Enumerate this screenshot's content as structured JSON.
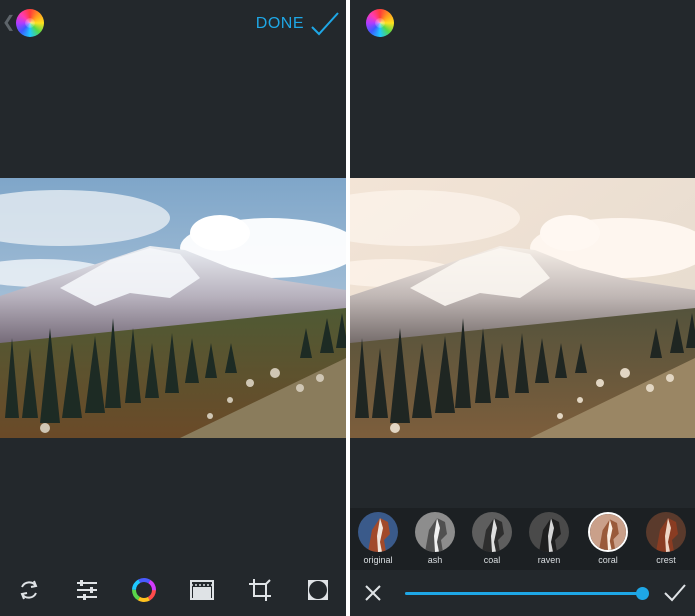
{
  "left_panel": {
    "back_icon": "chevron-left-icon",
    "logo_icon": "color-wheel-logo-icon",
    "done_label": "DONE",
    "done_icon": "checkmark-icon",
    "photo_description_icon": "mountain-photo",
    "toolbar": [
      {
        "name": "rotate-icon"
      },
      {
        "name": "adjust-sliders-icon"
      },
      {
        "name": "color-wheel-icon"
      },
      {
        "name": "film-icon"
      },
      {
        "name": "crop-icon"
      },
      {
        "name": "vignette-icon"
      }
    ]
  },
  "right_panel": {
    "logo_icon": "color-wheel-logo-icon",
    "filters": [
      {
        "label": "original",
        "tone": "original",
        "selected": false
      },
      {
        "label": "ash",
        "tone": "mono-light",
        "selected": false
      },
      {
        "label": "coal",
        "tone": "mono-dark",
        "selected": false
      },
      {
        "label": "raven",
        "tone": "mono-dark",
        "selected": false
      },
      {
        "label": "coral",
        "tone": "warm",
        "selected": true
      },
      {
        "label": "crest",
        "tone": "warm-dark",
        "selected": false
      }
    ],
    "cancel_icon": "close-icon",
    "apply_icon": "checkmark-icon",
    "intensity": 1.0
  },
  "colors": {
    "background": "#23282c",
    "accent": "#1ea7e6",
    "filter_strip": "#1c2023"
  }
}
